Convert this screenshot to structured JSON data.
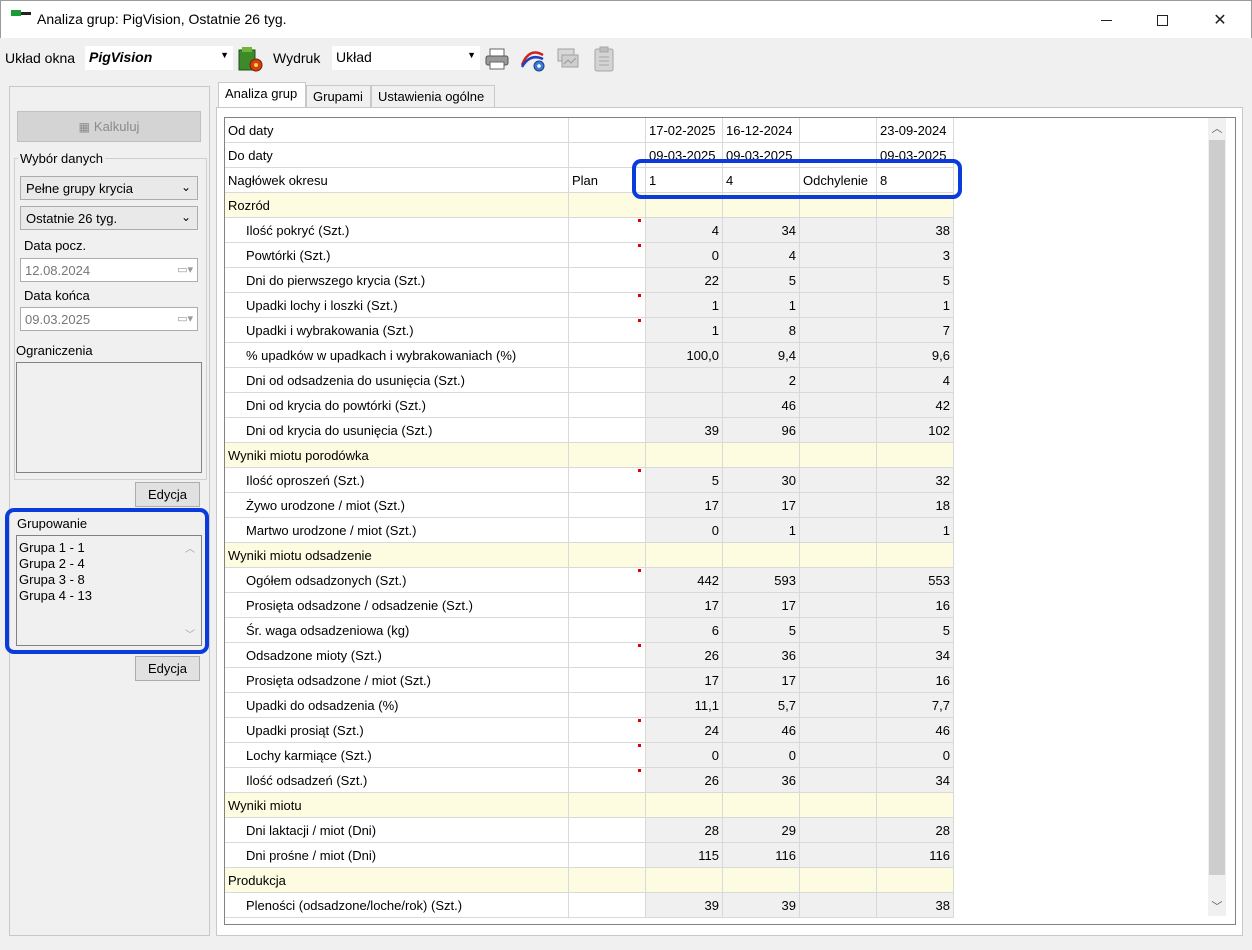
{
  "window": {
    "title": "Analiza grup: PigVision, Ostatnie 26 tyg."
  },
  "toolbar": {
    "layout_label": "Układ okna",
    "layout_value": "PigVision",
    "print_label": "Wydruk",
    "print_value": "Układ"
  },
  "left": {
    "calc_button": "Kalkuluj",
    "data_group_label": "Wybór danych",
    "group_type": "Pełne grupy krycia",
    "period": "Ostatnie 26 tyg.",
    "start_label": "Data pocz.",
    "start_value": "12.08.2024",
    "end_label": "Data końca",
    "end_value": "09.03.2025",
    "constraints_label": "Ograniczenia",
    "edit_button": "Edycja",
    "grouping_label": "Grupowanie",
    "groups": [
      "Grupa 1 - 1",
      "Grupa 2 - 4",
      "Grupa 3 - 8",
      "Grupa 4 - 13"
    ],
    "edit_button2": "Edycja"
  },
  "tabs": [
    "Analiza grup",
    "Grupami",
    "Ustawienia ogólne"
  ],
  "grid": {
    "header_rows": [
      {
        "label": "Od daty",
        "cols": [
          "",
          "17-02-2025",
          "16-12-2024",
          "",
          "23-09-2024"
        ]
      },
      {
        "label": "Do daty",
        "cols": [
          "",
          "09-03-2025",
          "09-03-2025",
          "",
          "09-03-2025"
        ]
      },
      {
        "label": "Nagłówek okresu",
        "cols": [
          "Plan",
          "1",
          "4",
          "Odchylenie",
          "8"
        ]
      }
    ],
    "sections": [
      {
        "title": "Rozród",
        "rows": [
          {
            "label": "Ilość pokryć (Szt.)",
            "v": [
              "4",
              "34",
              "38"
            ],
            "m": true
          },
          {
            "label": "Powtórki (Szt.)",
            "v": [
              "0",
              "4",
              "3"
            ],
            "m": true
          },
          {
            "label": "Dni do pierwszego krycia (Szt.)",
            "v": [
              "22",
              "5",
              "5"
            ],
            "m": false
          },
          {
            "label": "Upadki lochy i loszki (Szt.)",
            "v": [
              "1",
              "1",
              "1"
            ],
            "m": true
          },
          {
            "label": "Upadki i wybrakowania (Szt.)",
            "v": [
              "1",
              "8",
              "7"
            ],
            "m": true
          },
          {
            "label": "% upadków w upadkach i wybrakowaniach (%)",
            "v": [
              "100,0",
              "9,4",
              "9,6"
            ],
            "m": false
          },
          {
            "label": "Dni od odsadzenia do usunięcia (Szt.)",
            "v": [
              "",
              "2",
              "4"
            ],
            "m": false
          },
          {
            "label": "Dni od krycia do powtórki (Szt.)",
            "v": [
              "",
              "46",
              "42"
            ],
            "m": false
          },
          {
            "label": "Dni od krycia do usunięcia (Szt.)",
            "v": [
              "39",
              "96",
              "102"
            ],
            "m": false
          }
        ]
      },
      {
        "title": "Wyniki miotu porodówka",
        "rows": [
          {
            "label": "Ilość oproszeń (Szt.)",
            "v": [
              "5",
              "30",
              "32"
            ],
            "m": true
          },
          {
            "label": "Żywo urodzone / miot (Szt.)",
            "v": [
              "17",
              "17",
              "18"
            ],
            "m": false
          },
          {
            "label": "Martwo urodzone / miot (Szt.)",
            "v": [
              "0",
              "1",
              "1"
            ],
            "m": false
          }
        ]
      },
      {
        "title": "Wyniki miotu odsadzenie",
        "rows": [
          {
            "label": "Ogółem odsadzonych (Szt.)",
            "v": [
              "442",
              "593",
              "553"
            ],
            "m": true
          },
          {
            "label": "Prosięta odsadzone / odsadzenie (Szt.)",
            "v": [
              "17",
              "17",
              "16"
            ],
            "m": false
          },
          {
            "label": "Śr. waga odsadzeniowa (kg)",
            "v": [
              "6",
              "5",
              "5"
            ],
            "m": false
          },
          {
            "label": "Odsadzone mioty (Szt.)",
            "v": [
              "26",
              "36",
              "34"
            ],
            "m": true
          },
          {
            "label": "Prosięta odsadzone / miot (Szt.)",
            "v": [
              "17",
              "17",
              "16"
            ],
            "m": false
          },
          {
            "label": "Upadki do odsadzenia (%)",
            "v": [
              "11,1",
              "5,7",
              "7,7"
            ],
            "m": false
          },
          {
            "label": "Upadki prosiąt (Szt.)",
            "v": [
              "24",
              "46",
              "46"
            ],
            "m": true
          },
          {
            "label": "Lochy karmiące (Szt.)",
            "v": [
              "0",
              "0",
              "0"
            ],
            "m": true
          },
          {
            "label": "Ilość odsadzeń (Szt.)",
            "v": [
              "26",
              "36",
              "34"
            ],
            "m": true
          }
        ]
      },
      {
        "title": "Wyniki miotu",
        "rows": [
          {
            "label": "Dni laktacji / miot (Dni)",
            "v": [
              "28",
              "29",
              "28"
            ],
            "m": false
          },
          {
            "label": "Dni prośne / miot (Dni)",
            "v": [
              "115",
              "116",
              "116"
            ],
            "m": false
          }
        ]
      },
      {
        "title": "Produkcja",
        "rows": [
          {
            "label": "Pleności (odsadzone/loche/rok) (Szt.)",
            "v": [
              "39",
              "39",
              "38"
            ],
            "m": false
          }
        ]
      }
    ]
  }
}
